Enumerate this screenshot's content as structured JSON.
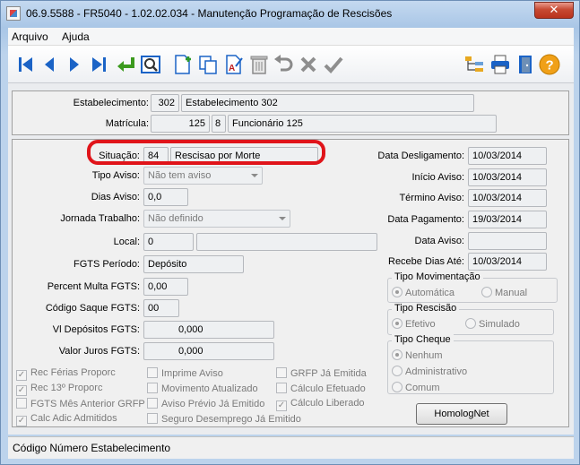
{
  "window": {
    "title": "06.9.5588 - FR5040 - 1.02.02.034 - Manutenção Programação de Rescisões",
    "close_label": "✕"
  },
  "menu": {
    "items": [
      {
        "label": "Arquivo"
      },
      {
        "label": "Ajuda"
      }
    ]
  },
  "toolbar": {
    "buttons": [
      {
        "name": "first-record-icon"
      },
      {
        "name": "previous-record-icon"
      },
      {
        "name": "next-record-icon"
      },
      {
        "name": "last-record-icon"
      },
      {
        "name": "goto-icon"
      },
      {
        "name": "search-icon"
      },
      {
        "name": "new-icon"
      },
      {
        "name": "copy-icon"
      },
      {
        "name": "edit-icon"
      },
      {
        "name": "delete-icon"
      },
      {
        "name": "undo-icon"
      },
      {
        "name": "cancel-icon"
      },
      {
        "name": "confirm-icon"
      },
      {
        "name": "tree-icon"
      },
      {
        "name": "print-icon"
      },
      {
        "name": "exit-icon"
      },
      {
        "name": "help-icon"
      }
    ]
  },
  "header": {
    "estabelecimento_label": "Estabelecimento:",
    "estabelecimento_code": "302",
    "estabelecimento_name": "Estabelecimento 302",
    "matricula_label": "Matrícula:",
    "matricula_code": "125",
    "matricula_digit": "8",
    "matricula_name": "Funcionário 125"
  },
  "form": {
    "situacao_label": "Situação:",
    "situacao_code": "84",
    "situacao_desc": "Rescisao por Morte",
    "tipo_aviso_label": "Tipo Aviso:",
    "tipo_aviso_value": "Não tem aviso",
    "dias_aviso_label": "Dias Aviso:",
    "dias_aviso_value": "0,0",
    "jornada_label": "Jornada Trabalho:",
    "jornada_value": "Não definido",
    "local_label": "Local:",
    "local_value": "0",
    "fgts_periodo_label": "FGTS Período:",
    "fgts_periodo_value": "Depósito",
    "percent_multa_label": "Percent Multa FGTS:",
    "percent_multa_value": "0,00",
    "codigo_saque_label": "Código Saque FGTS:",
    "codigo_saque_value": "00",
    "vl_depositos_label": "Vl Depósitos FGTS:",
    "vl_depositos_value": "0,000",
    "valor_juros_label": "Valor Juros FGTS:",
    "valor_juros_value": "0,000"
  },
  "dates": {
    "desligamento_label": "Data Desligamento:",
    "desligamento_value": "10/03/2014",
    "inicio_aviso_label": "Início Aviso:",
    "inicio_aviso_value": "10/03/2014",
    "termino_aviso_label": "Término Aviso:",
    "termino_aviso_value": "10/03/2014",
    "pagamento_label": "Data Pagamento:",
    "pagamento_value": "19/03/2014",
    "data_aviso_label": "Data Aviso:",
    "data_aviso_value": "",
    "recebe_dias_label": "Recebe Dias Até:",
    "recebe_dias_value": "10/03/2014"
  },
  "groups": {
    "tipo_movimentacao": {
      "title": "Tipo Movimentação",
      "options": [
        "Automática",
        "Manual"
      ],
      "selected": "Automática"
    },
    "tipo_rescisao": {
      "title": "Tipo Rescisão",
      "options": [
        "Efetivo",
        "Simulado"
      ],
      "selected": "Efetivo"
    },
    "tipo_cheque": {
      "title": "Tipo Cheque",
      "options": [
        "Nenhum",
        "Administrativo",
        "Comum"
      ],
      "selected": "Nenhum"
    }
  },
  "checkboxes": {
    "rec_ferias": {
      "label": "Rec Férias Proporc",
      "checked": true
    },
    "rec_13": {
      "label": "Rec 13º Proporc",
      "checked": true
    },
    "fgts_mes_anterior": {
      "label": "FGTS Mês Anterior GRFP",
      "checked": false
    },
    "calc_adic": {
      "label": "Calc Adic Admitidos",
      "checked": true
    },
    "imprime_aviso": {
      "label": "Imprime Aviso",
      "checked": false
    },
    "movimento_atualizado": {
      "label": "Movimento Atualizado",
      "checked": false
    },
    "aviso_previo": {
      "label": "Aviso Prévio Já Emitido",
      "checked": false
    },
    "seguro_desemprego": {
      "label": "Seguro Desemprego Já Emitido",
      "checked": false
    },
    "grfp_emitida": {
      "label": "GRFP Já Emitida",
      "checked": false
    },
    "calculo_efetuado": {
      "label": "Cálculo Efetuado",
      "checked": false
    },
    "calculo_liberado": {
      "label": "Cálculo Liberado",
      "checked": true
    }
  },
  "homolognet_label": "HomologNet",
  "status": {
    "text": "Código Número Estabelecimento"
  },
  "colors": {
    "accent": "#1b63c6",
    "highlight": "#e0141a"
  }
}
